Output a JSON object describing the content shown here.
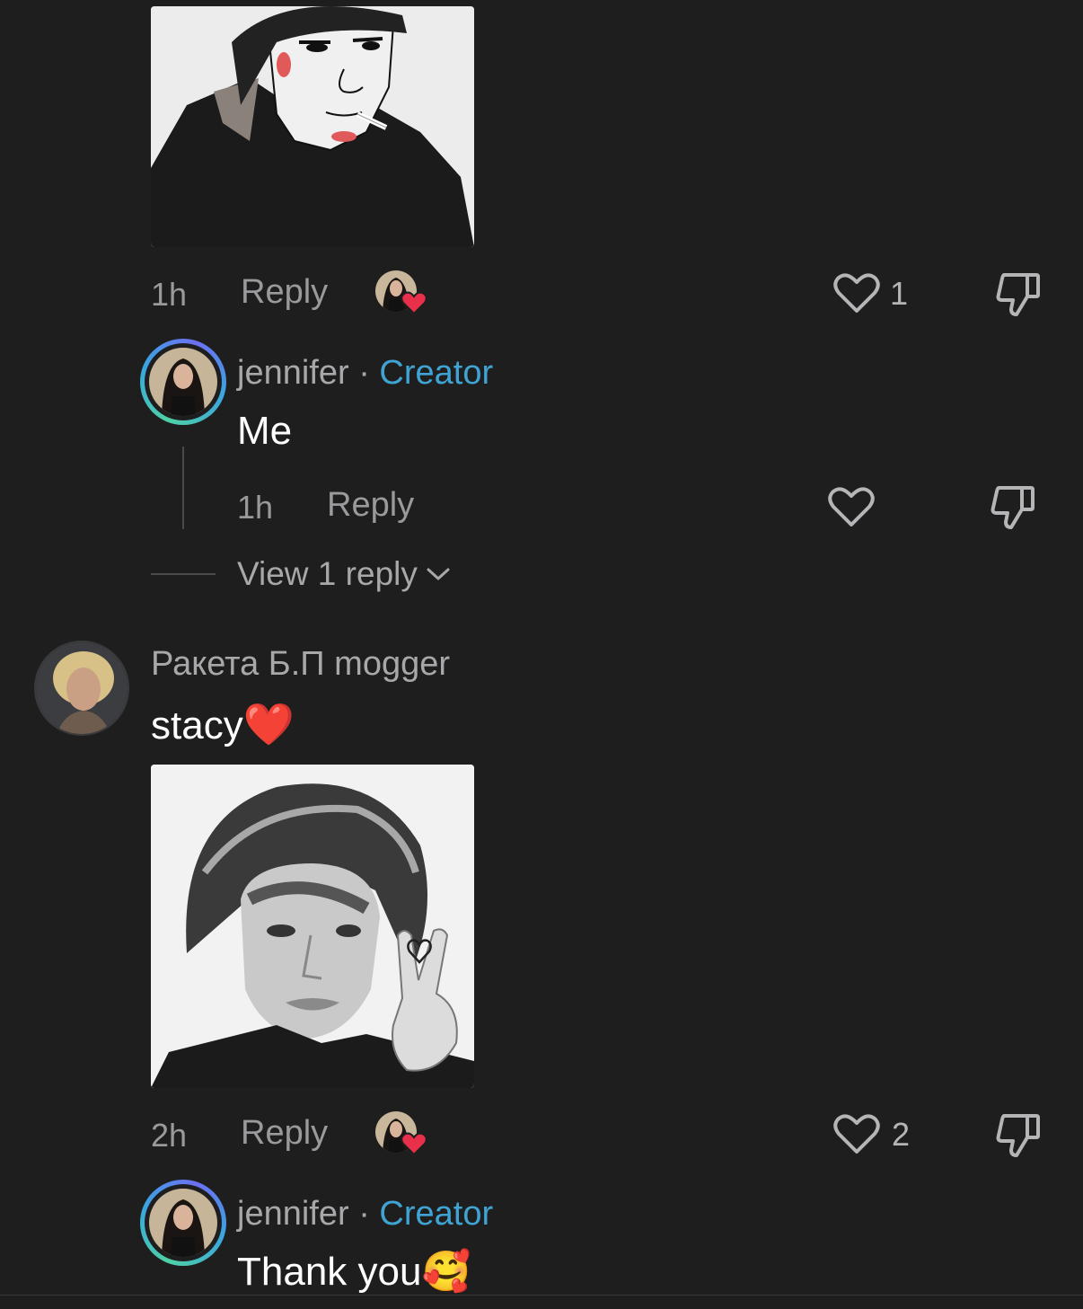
{
  "comment1": {
    "time": "1h",
    "reply_label": "Reply",
    "like_count": "1"
  },
  "reply1": {
    "username": "jennifer",
    "separator": "·",
    "badge": "Creator",
    "text": "Me",
    "time": "1h",
    "reply_label": "Reply"
  },
  "view_replies": {
    "label": "View 1 reply"
  },
  "comment2": {
    "username": "Ракета Б.П mogger",
    "text": "stacy",
    "emoji": "❤️",
    "time": "2h",
    "reply_label": "Reply",
    "like_count": "2"
  },
  "reply2": {
    "username": "jennifer",
    "separator": "·",
    "badge": "Creator",
    "text": "Thank you",
    "emoji": "🥰"
  },
  "colors": {
    "background": "#1e1e1f",
    "creator_badge": "#3fa3d4",
    "secondary_text": "#9a9a9c",
    "creator_heart": "#e8304a"
  },
  "icons": [
    "heart-outline-icon",
    "dislike-icon",
    "chevron-down-icon",
    "creator-liked-heart-icon"
  ]
}
